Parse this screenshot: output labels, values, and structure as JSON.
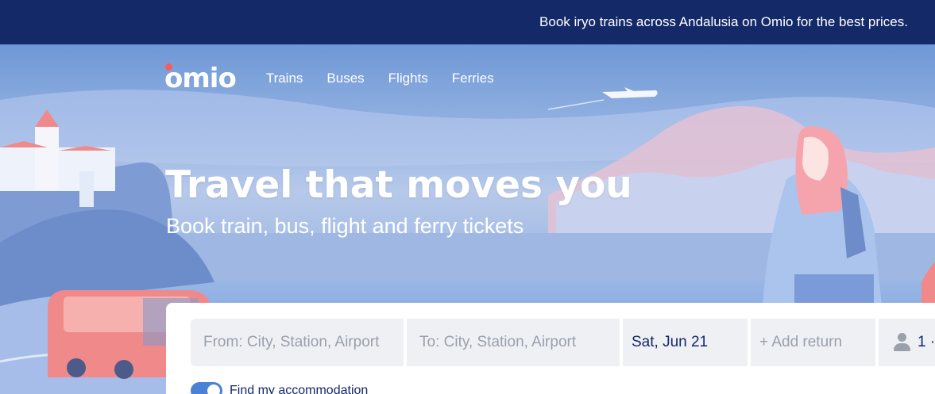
{
  "banner": {
    "text": "Book iryo trains across Andalusia on Omio for the best prices."
  },
  "brand": {
    "logo_text": "omio",
    "accent": "#fc5a5a",
    "navy": "#132968"
  },
  "nav": {
    "items": [
      "Trains",
      "Buses",
      "Flights",
      "Ferries"
    ]
  },
  "hero": {
    "title": "Travel that moves you",
    "subtitle": "Book train, bus, flight and ferry tickets"
  },
  "search": {
    "from_placeholder": "From: City, Station, Airport",
    "to_placeholder": "To: City, Station, Airport",
    "date": "Sat, Jun 21",
    "return_label": "+ Add return",
    "passengers": "1 ·",
    "passenger_icon": "person-icon"
  },
  "options": {
    "accommodation_label": "Find my accommodation",
    "accommodation_enabled": true
  }
}
